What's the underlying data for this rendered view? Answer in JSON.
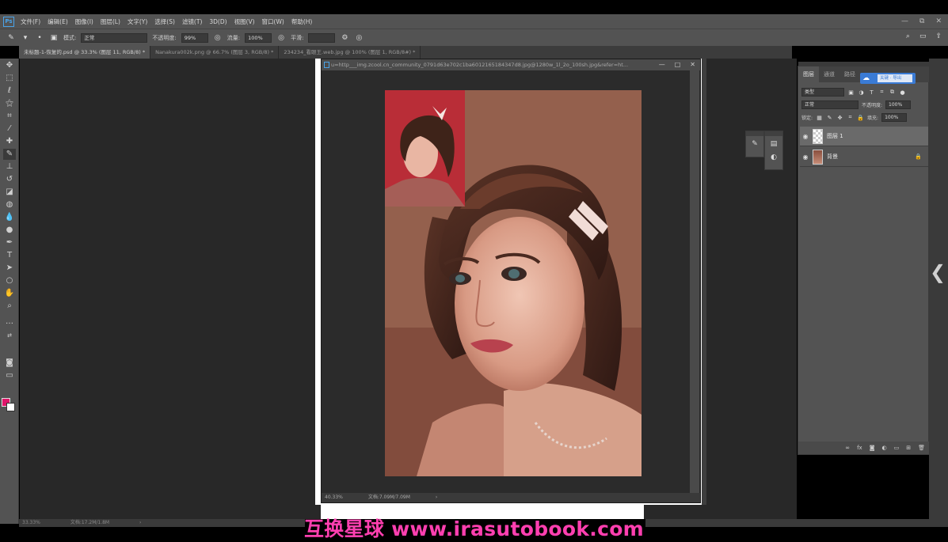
{
  "menubar": {
    "logo": "Ps",
    "items": [
      "文件(F)",
      "编辑(E)",
      "图像(I)",
      "图层(L)",
      "文字(Y)",
      "选择(S)",
      "滤镜(T)",
      "3D(D)",
      "视图(V)",
      "窗口(W)",
      "帮助(H)"
    ],
    "controls": [
      "—",
      "⧉",
      "✕"
    ]
  },
  "options": {
    "mode_label": "模式:",
    "mode_value": "正常",
    "opacity_label": "不透明度:",
    "opacity_value": "99%",
    "flow_label": "流量:",
    "flow_value": "100%",
    "smooth_label": "平滑:",
    "smooth_value": ""
  },
  "tabs": [
    "未标题-1-恢复的.psd @ 33.3% (图层 11, RGB/8) *",
    "Nanakura002k.png @ 66.7% (图层 3, RGB/8) *",
    "234234_看眼王.web.jpg @ 100% (图层 1, RGB/8#) *"
  ],
  "float_window": {
    "title": "u=http___img.zcool.cn_community_0791d63e702c1ba6012165184347d8.jpg@1280w_1l_2o_100sh.jpg&refer=ht...",
    "zoom": "40.33%",
    "doc": "文档:7.09M/7.09M"
  },
  "status": {
    "zoom": "33.33%",
    "doc": "文档:17.2M/1.8M"
  },
  "layers_panel": {
    "tabs": [
      "图层",
      "通道",
      "路径"
    ],
    "badge_text": "关键 · 导出",
    "filter_label": "类型",
    "blend_mode": "正常",
    "opacity_label": "不透明度:",
    "opacity_value": "100%",
    "lock_label": "锁定:",
    "fill_label": "填充:",
    "fill_value": "100%",
    "layers": [
      {
        "name": "图层 1",
        "selected": true
      },
      {
        "name": "背景",
        "selected": false
      }
    ]
  },
  "watermark": "互换星球 www.irasutobook.com",
  "colors": {
    "foreground": "#e0156a",
    "background": "#ffffff",
    "watermark": "#ff3fb0",
    "accent": "#3a7bd5"
  }
}
